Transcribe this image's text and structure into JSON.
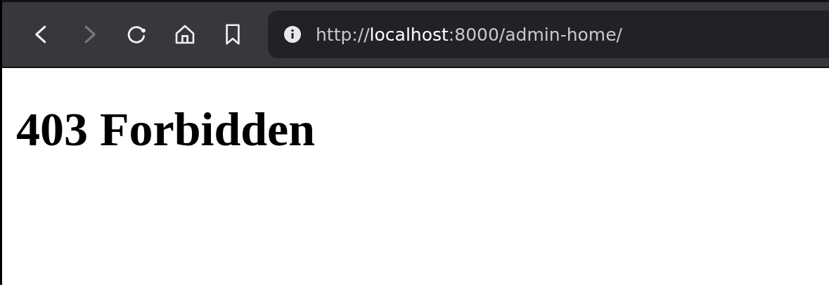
{
  "toolbar": {
    "buttons": [
      {
        "kind": "back",
        "disabled": false
      },
      {
        "kind": "forward",
        "disabled": true
      },
      {
        "kind": "reload",
        "disabled": false
      },
      {
        "kind": "home",
        "disabled": false
      },
      {
        "kind": "bookmark",
        "disabled": false
      }
    ],
    "address": "http://**localhost**:8000/admin-home/"
  },
  "page": {
    "heading": "403 Forbidden"
  }
}
